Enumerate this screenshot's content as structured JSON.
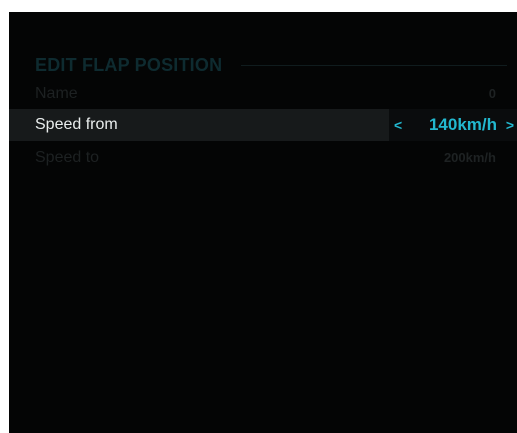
{
  "panel": {
    "title": "EDIT FLAP POSITION"
  },
  "rows": [
    {
      "label": "Name",
      "value": "0",
      "state": "dim"
    },
    {
      "label": "Speed from",
      "value": "140km/h",
      "state": "selected",
      "left_arrow": "<",
      "right_arrow": ">"
    },
    {
      "label": "Speed to",
      "value": "200km/h",
      "state": "dim"
    }
  ],
  "colors": {
    "background": "#040505",
    "accent": "#22b8cf",
    "selected_row": "#171a1b",
    "dim_text": "#1d2122",
    "title_text": "#0e2b30"
  }
}
